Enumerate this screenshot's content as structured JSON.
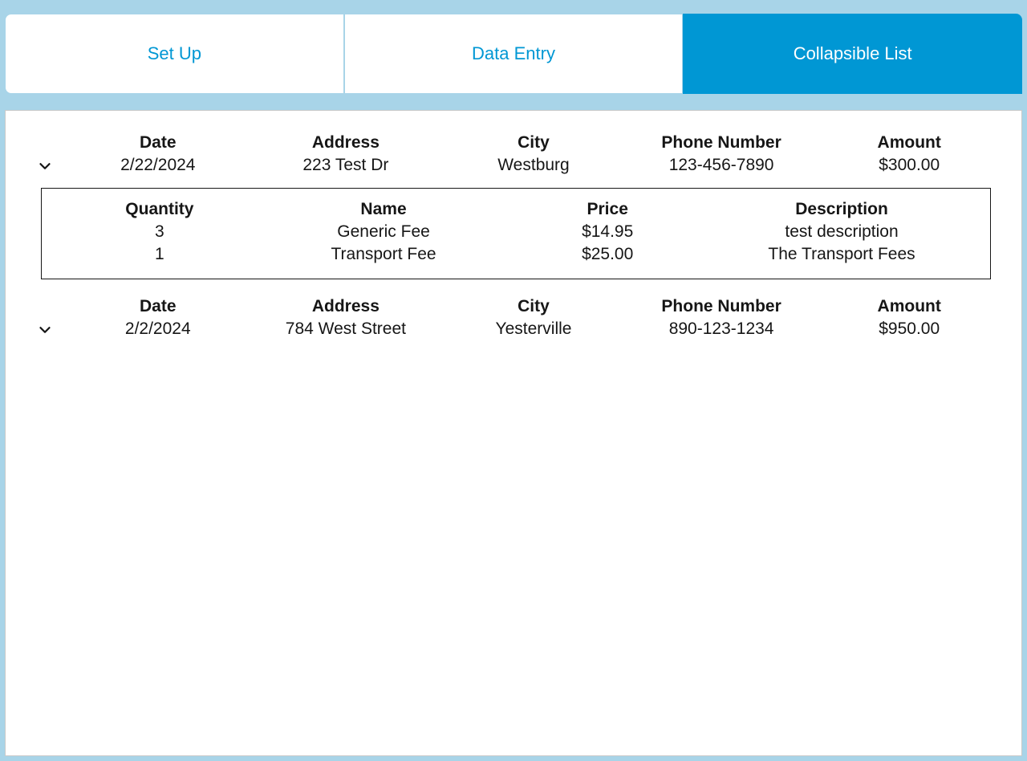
{
  "tabs": {
    "setup": "Set Up",
    "data_entry": "Data Entry",
    "collapsible_list": "Collapsible List"
  },
  "headers": {
    "date": "Date",
    "address": "Address",
    "city": "City",
    "phone": "Phone Number",
    "amount": "Amount"
  },
  "detail_headers": {
    "quantity": "Quantity",
    "name": "Name",
    "price": "Price",
    "description": "Description"
  },
  "rows": [
    {
      "date": "2/22/2024",
      "address": "223 Test Dr",
      "city": "Westburg",
      "phone": "123-456-7890",
      "amount": "$300.00",
      "expanded": true,
      "details": [
        {
          "quantity": "3",
          "name": "Generic Fee",
          "price": "$14.95",
          "description": "test description"
        },
        {
          "quantity": "1",
          "name": "Transport Fee",
          "price": "$25.00",
          "description": "The Transport Fees"
        }
      ]
    },
    {
      "date": "2/2/2024",
      "address": "784 West Street",
      "city": "Yesterville",
      "phone": "890-123-1234",
      "amount": "$950.00",
      "expanded": false,
      "details": []
    }
  ]
}
